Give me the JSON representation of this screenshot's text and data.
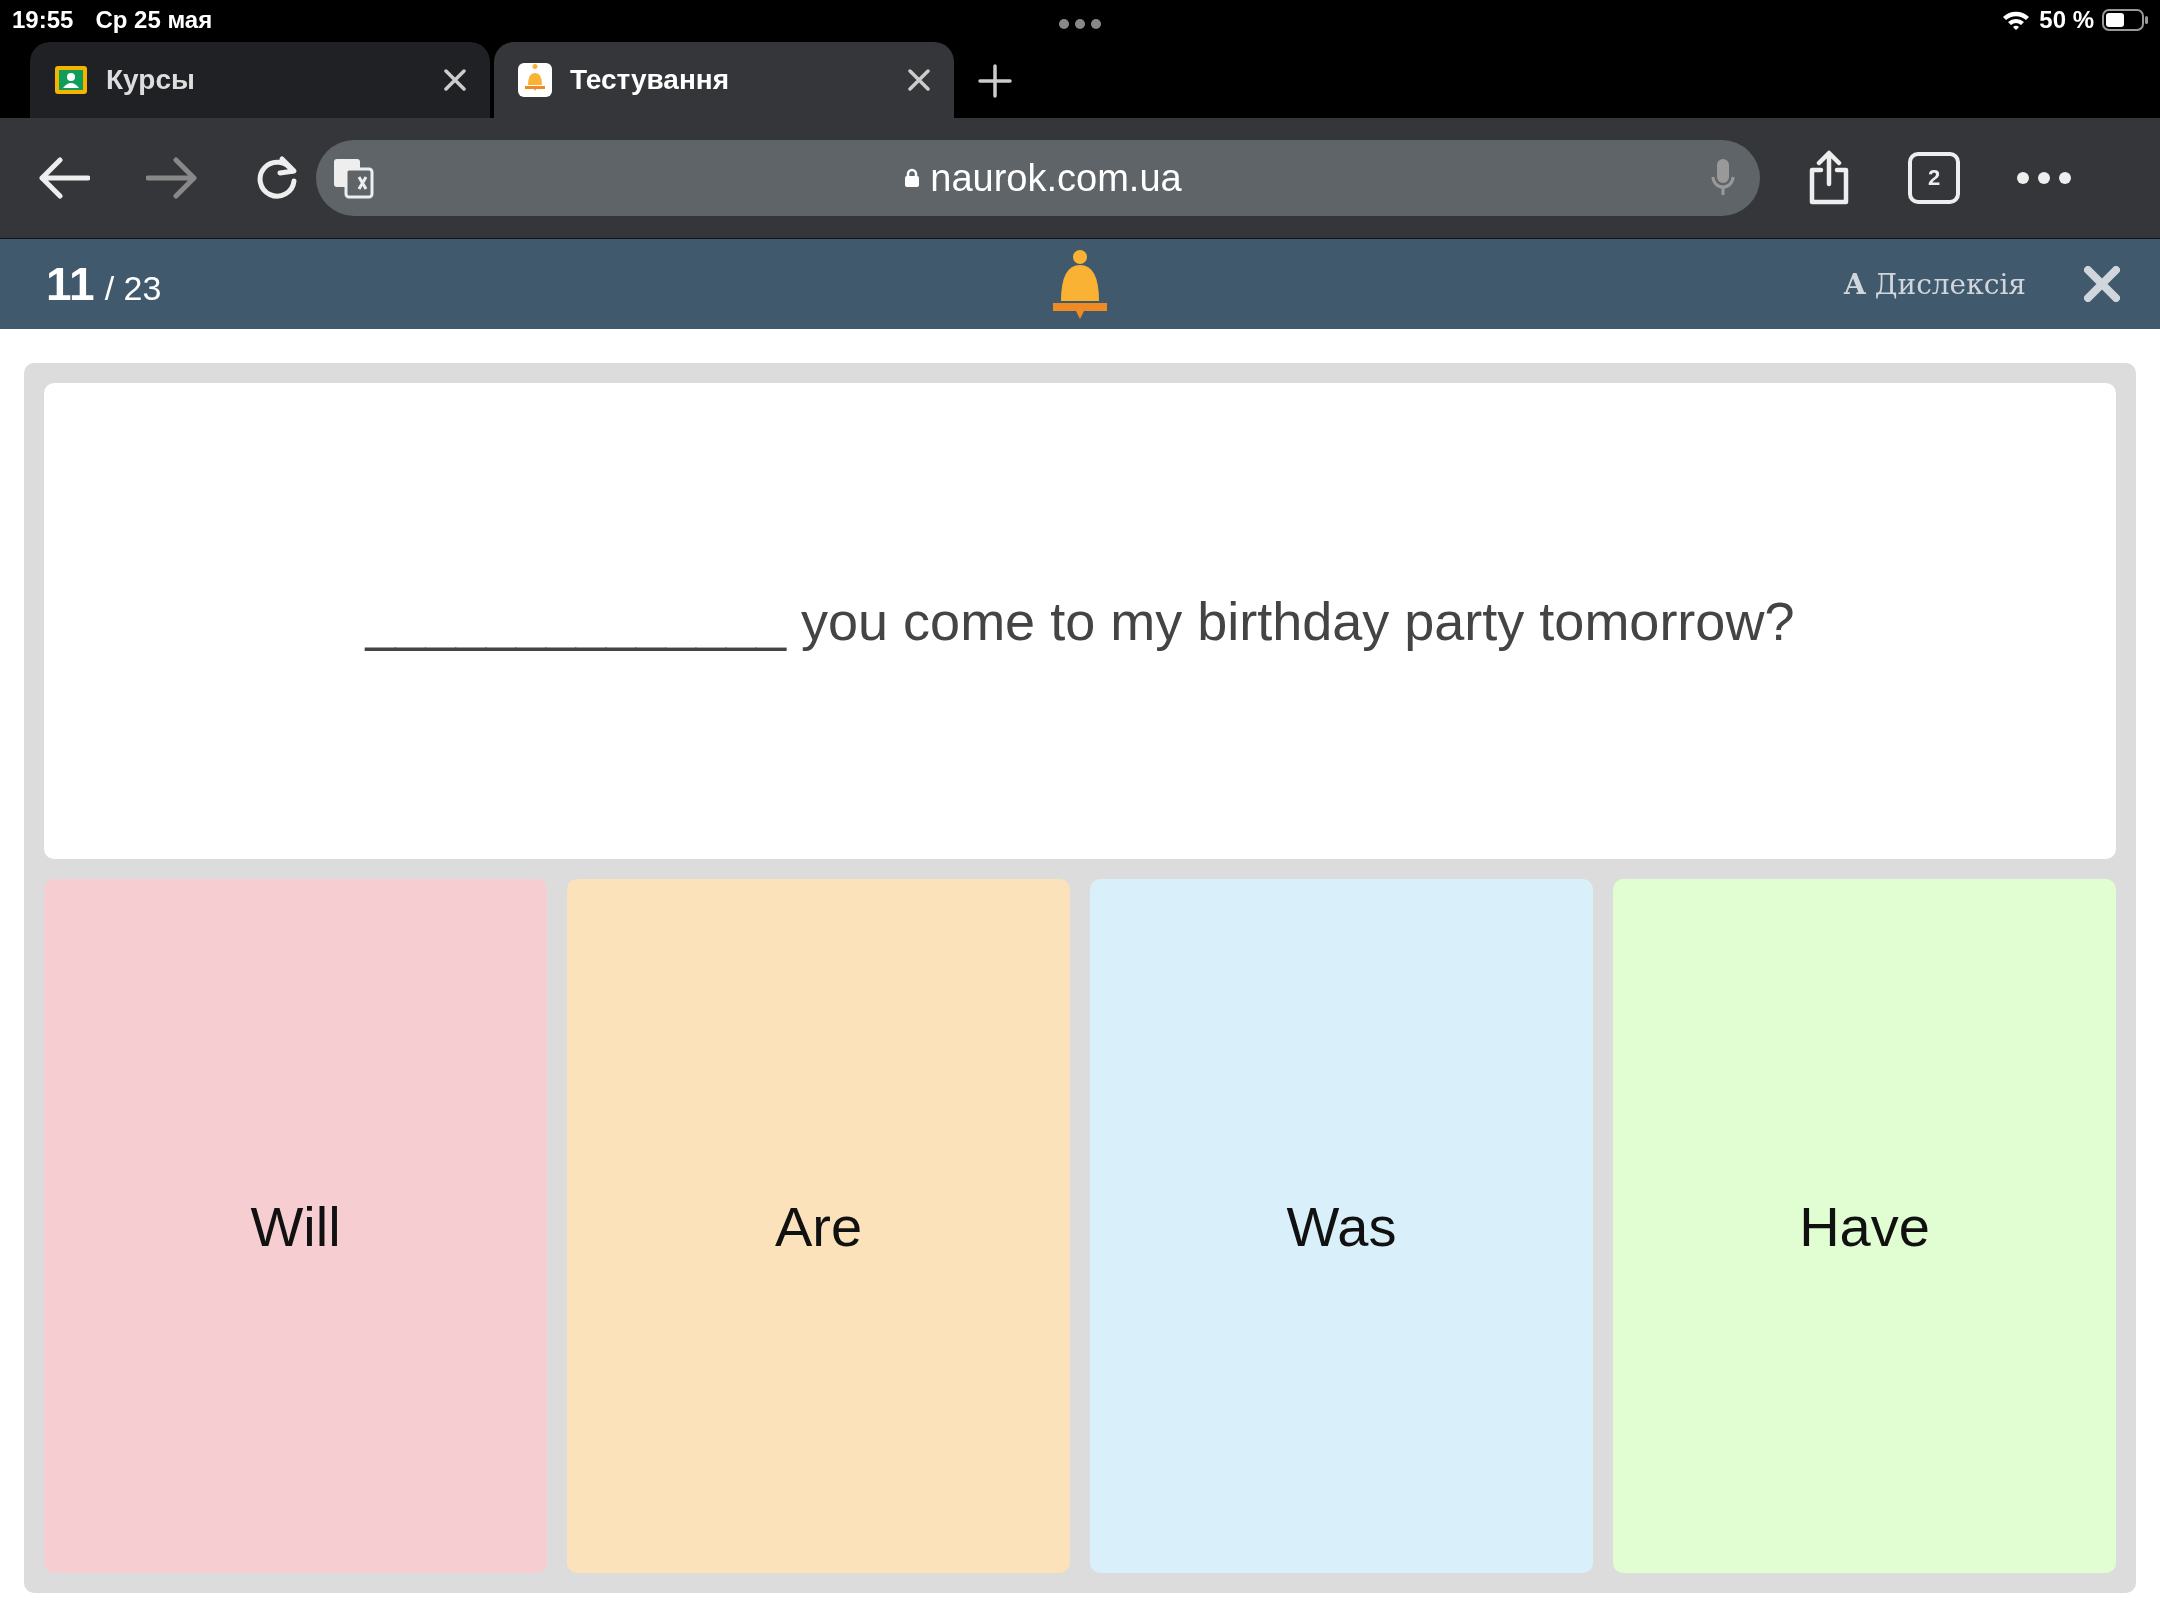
{
  "status_bar": {
    "time": "19:55",
    "date": "Ср 25 мая",
    "battery": "50 %"
  },
  "tabs": [
    {
      "title": "Курсы",
      "kind": "classroom",
      "selected": false
    },
    {
      "title": "Тестування",
      "kind": "naurok",
      "selected": true
    }
  ],
  "toolbar": {
    "url": "naurok.com.ua",
    "tab_count": "2"
  },
  "quiz_header": {
    "current": "11",
    "total": "/ 23",
    "dyslexia": "**A** Дислексія"
  },
  "question": "______________ you come to my birthday party tomorrow?",
  "answers": [
    {
      "text": "Will",
      "color": "#f6cdd0"
    },
    {
      "text": "Are",
      "color": "#fbe2bb"
    },
    {
      "text": "Was",
      "color": "#d9f0fb"
    },
    {
      "text": "Have",
      "color": "#e1fdd2"
    }
  ]
}
